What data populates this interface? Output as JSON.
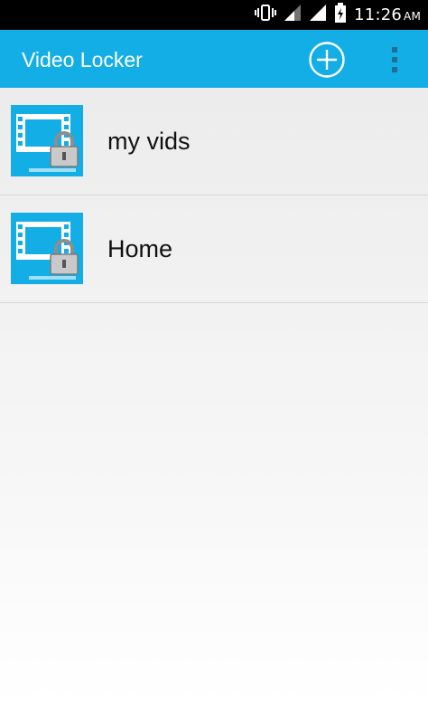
{
  "status_bar": {
    "time": "11:26",
    "ampm": "AM",
    "icons": [
      "vibrate-icon",
      "signal-icon",
      "signal-icon",
      "battery-charging-icon"
    ]
  },
  "app_bar": {
    "title": "Video Locker",
    "background": "#14aee6",
    "actions": [
      "add-circle-icon",
      "overflow-menu-icon"
    ]
  },
  "list": {
    "items": [
      {
        "label": "my vids",
        "icon": "video-lock-thumbnail"
      },
      {
        "label": "Home",
        "icon": "video-lock-thumbnail"
      }
    ]
  }
}
